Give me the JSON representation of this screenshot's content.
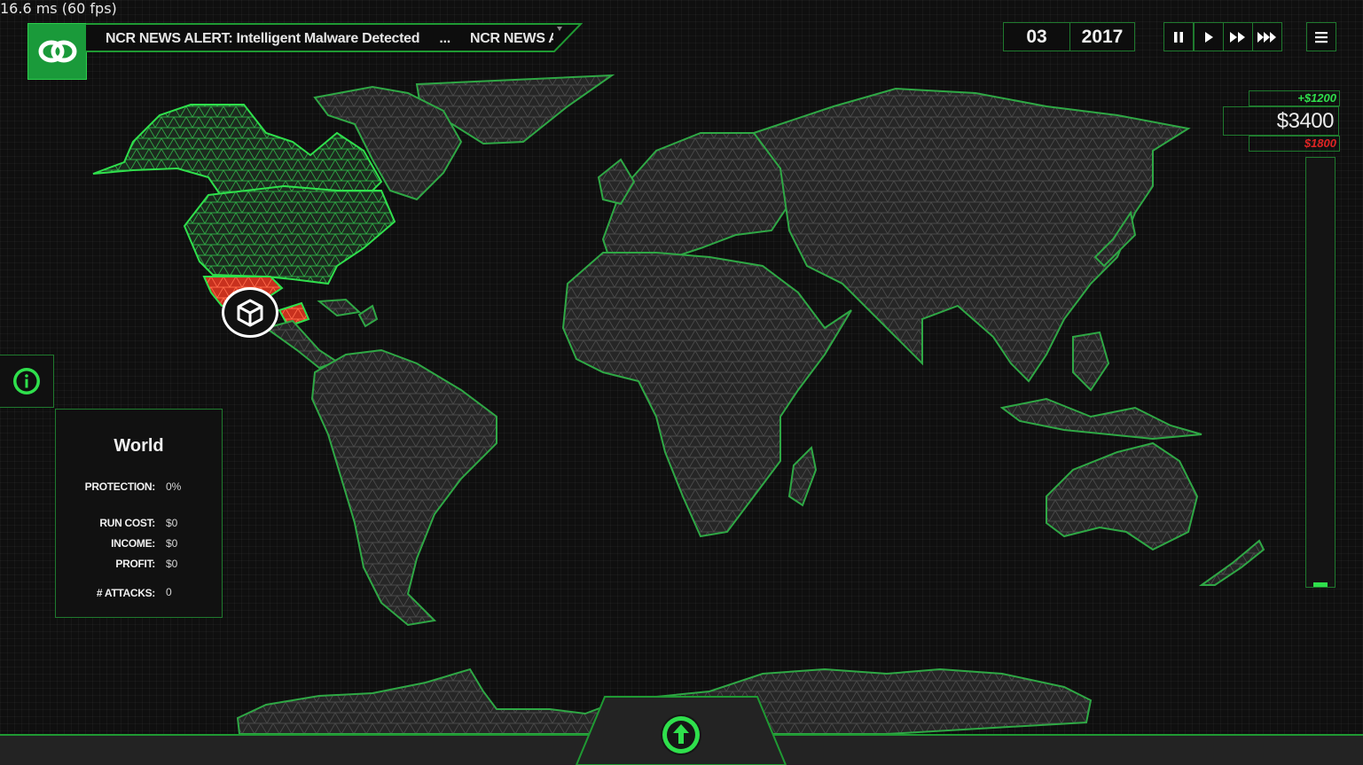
{
  "debug": {
    "fps_text": "16.6 ms (60 fps)"
  },
  "news_ticker": {
    "items": [
      "NCR NEWS ALERT: Intelligent Malware Detected",
      "...",
      "NCR NEWS ALER"
    ]
  },
  "date": {
    "month": "03",
    "year": "2017"
  },
  "speed_controls": {
    "pause_icon": "pause-icon",
    "play_icon": "play-icon",
    "fast_icon": "fast-forward-icon",
    "fastest_icon": "fastest-forward-icon",
    "menu_icon": "hamburger-menu-icon"
  },
  "finances": {
    "income_delta": "+$1200",
    "balance": "$3400",
    "cost_delta": "$1800",
    "balance_bar_fill_fraction": 0.01
  },
  "info_panel": {
    "title": "World",
    "protection_label": "PROTECTION:",
    "protection_value": "0%",
    "run_cost_label": "RUN COST:",
    "run_cost_value": "$0",
    "income_label": "INCOME:",
    "income_value": "$0",
    "profit_label": "PROFIT:",
    "profit_value": "$0",
    "attacks_label": "# ATTACKS:",
    "attacks_value": "0"
  },
  "map": {
    "highlighted_region": "Western United States",
    "base_icon": "cube-icon"
  },
  "colors": {
    "accent_green": "#2fe04c",
    "border_green": "#1f7a2e",
    "alert_red": "#e02424",
    "map_fill": "#2a2a2a"
  },
  "icons": {
    "logo": "linked-rings-logo-icon",
    "info": "info-icon",
    "upgrade": "arrow-up-circle-icon"
  }
}
